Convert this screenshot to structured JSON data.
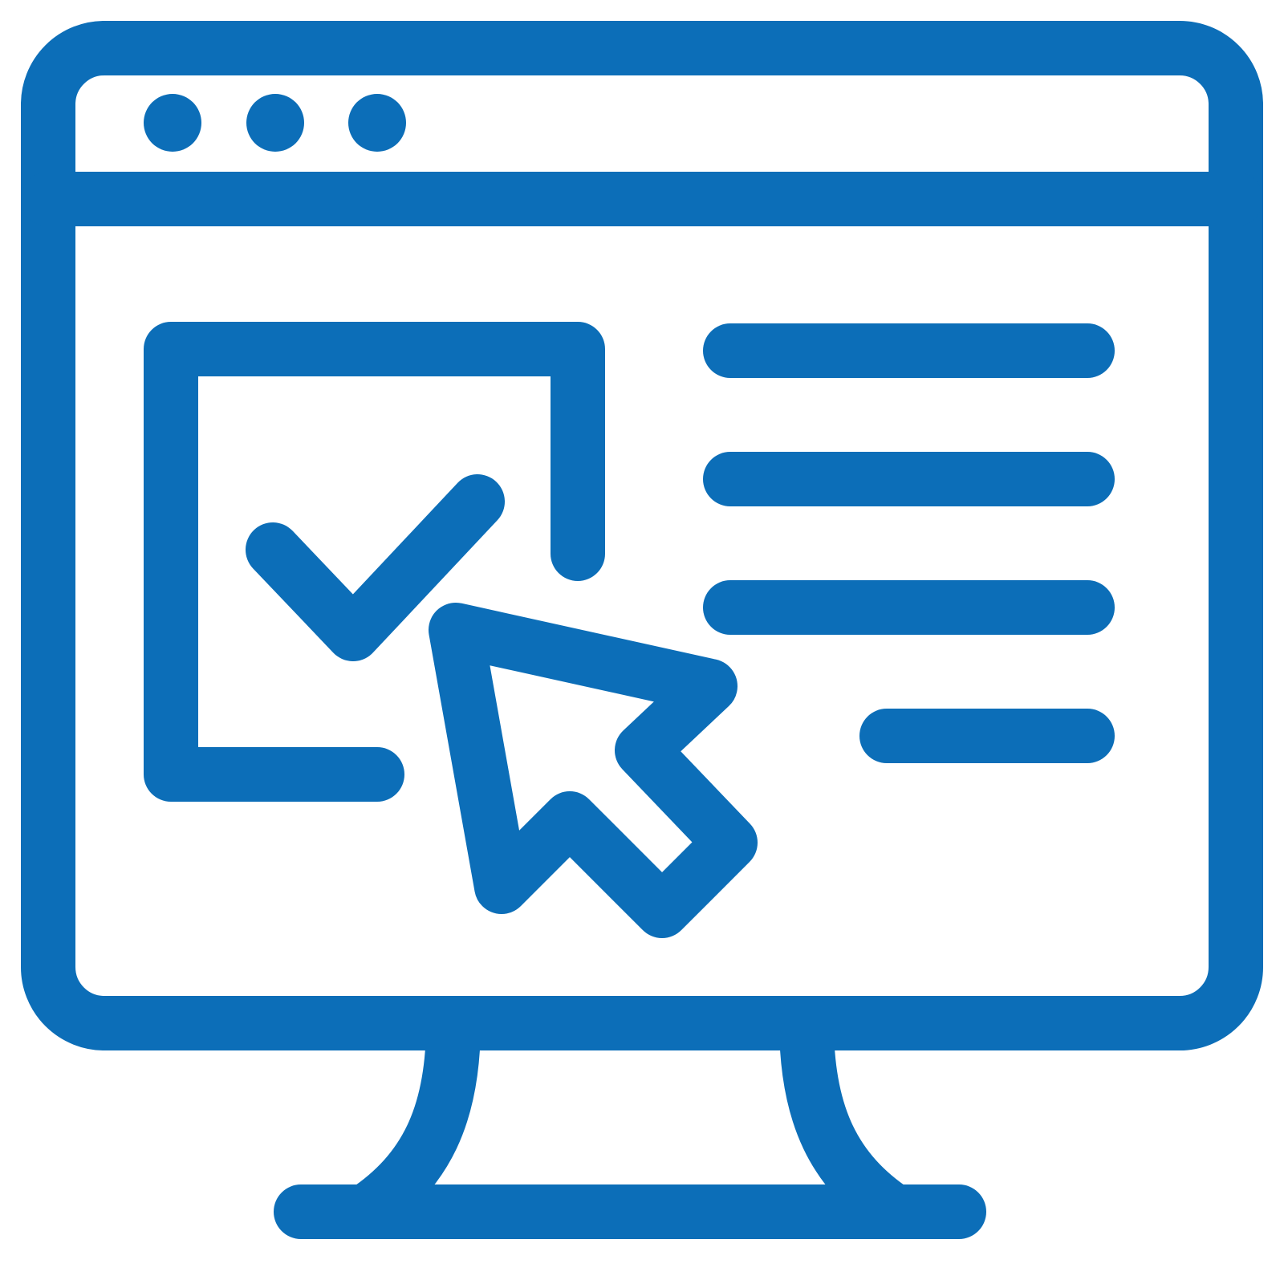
{
  "icon": {
    "name": "computer-monitor-click-icon",
    "color": "#0C6EB8",
    "parts": [
      "monitor-frame-icon",
      "browser-dots-icon",
      "checkbox-icon",
      "checkmark-icon",
      "text-lines-icon",
      "mouse-pointer-icon",
      "monitor-stand-icon"
    ]
  }
}
